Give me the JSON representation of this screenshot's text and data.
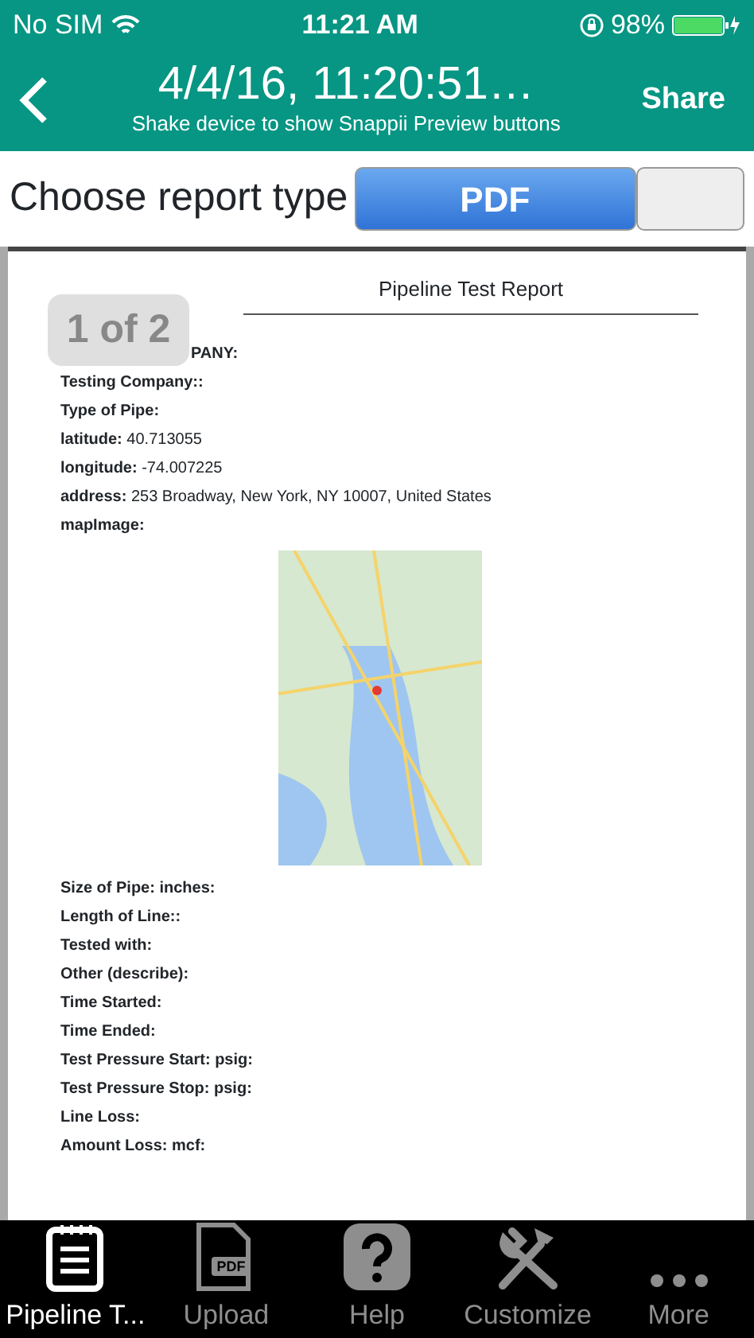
{
  "status_bar": {
    "carrier": "No SIM",
    "time": "11:21 AM",
    "battery": "98%"
  },
  "nav_bar": {
    "title": "4/4/16, 11:20:51…",
    "subtitle": "Shake device to show Snappii Preview buttons",
    "action": "Share"
  },
  "report_type": {
    "label": "Choose report type",
    "segments": [
      {
        "label": "PDF",
        "selected": true
      },
      {
        "selected": false
      }
    ]
  },
  "document": {
    "page_badge": "1 of 2",
    "title": "Pipeline Test Report",
    "fields": [
      {
        "kind": "text",
        "text": "PANY:"
      },
      {
        "kind": "text",
        "text": "Testing Company::"
      },
      {
        "kind": "text",
        "text": "Type of Pipe:"
      },
      {
        "kind": "text",
        "text": "**latitude:** 40.713055"
      },
      {
        "kind": "text",
        "text": "**longitude:** -74.007225"
      },
      {
        "kind": "text",
        "text": "**address:** 253 Broadway, New York, NY  10007, United States"
      },
      {
        "kind": "text",
        "text": " mapImage:"
      },
      {
        "kind": "map"
      },
      {
        "kind": "text",
        "text": "Size of Pipe: inches:"
      },
      {
        "kind": "text",
        "text": "Length of Line::"
      },
      {
        "kind": "text",
        "text": "Tested with:"
      },
      {
        "kind": "text",
        "text": "Other (describe):"
      },
      {
        "kind": "text",
        "text": "Time Started:"
      },
      {
        "kind": "text",
        "text": "Time Ended:"
      },
      {
        "kind": "text",
        "text": "Test Pressure Start: psig:"
      },
      {
        "kind": "text",
        "text": "Test Pressure Stop: psig:"
      },
      {
        "kind": "text",
        "text": "Line Loss:"
      },
      {
        "kind": "text",
        "text": "Amount Loss: mcf:"
      }
    ]
  },
  "tab_bar": [
    {
      "label": "Pipeline T...",
      "kind": "notepad",
      "selected": true
    },
    {
      "label": "Upload",
      "kind": "pdf",
      "icon_text": "PDF",
      "selected": false
    },
    {
      "label": "Help",
      "kind": "help",
      "selected": false
    },
    {
      "label": "Customize",
      "kind": "tools",
      "selected": false
    },
    {
      "label": "More",
      "kind": "more",
      "selected": false
    }
  ]
}
